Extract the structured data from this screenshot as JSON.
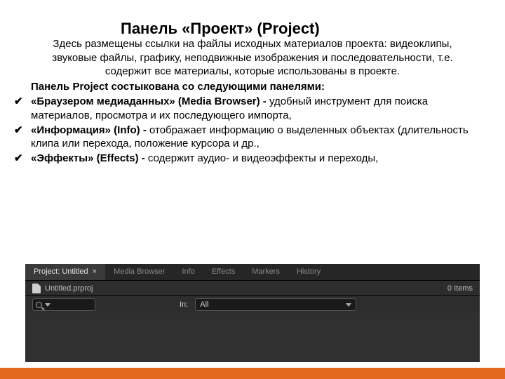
{
  "title": "Панель «Проект» (Project)",
  "intro": "Здесь размещены ссылки на файлы исходных материалов проекта: видеоклипы, звуковые файлы, графику, неподвижные изображения и последовательности, т.е. содержит все материалы, которые использованы в проекте.",
  "subheading": "Панель Project состыкована со следующими панелями:",
  "bullets": [
    {
      "strong": "«Браузером медиаданных» (Media Browser) -",
      "rest": " удобный инструмент для поиска материалов, просмотра и их последующего импорта,"
    },
    {
      "strong": "«Информация» (Info) -",
      "rest": " отображает информацию о выделенных объектах (длительность клипа или перехода, положение курсора и др.,"
    },
    {
      "strong": "«Эффекты» (Effects) -",
      "rest": " содержит аудио- и видеоэффекты и переходы,"
    }
  ],
  "app": {
    "tabs": [
      "Project: Untitled",
      "Media Browser",
      "Info",
      "Effects",
      "Markers",
      "History"
    ],
    "project_name": "Untitled.prproj",
    "item_count": "0 Items",
    "in_label": "In:",
    "in_value": "All"
  }
}
